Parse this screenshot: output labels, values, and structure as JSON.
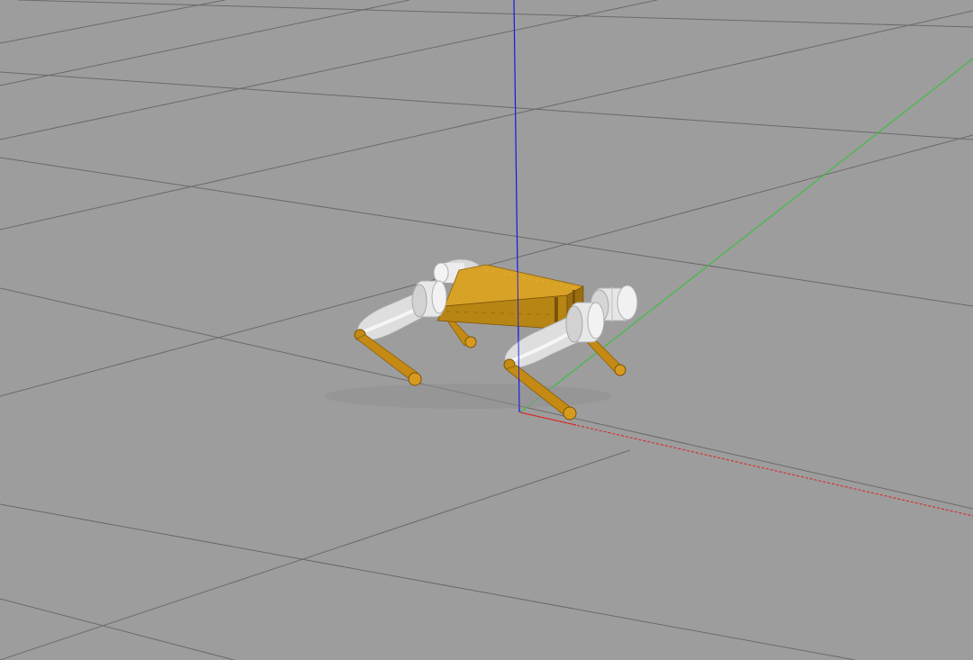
{
  "scene": {
    "background_color": "#9d9d9d",
    "grid_color": "#5f5f5f",
    "axes": {
      "x_color": "#e02020",
      "y_color": "#20c020",
      "z_color": "#1010e0"
    },
    "robot": {
      "body_color": "#c8961a",
      "body_dark_color": "#9a6e0e",
      "motor_color": "#e6e6e6",
      "motor_shade_color": "#b8b8b8",
      "leg_color": "#c48a14"
    }
  }
}
